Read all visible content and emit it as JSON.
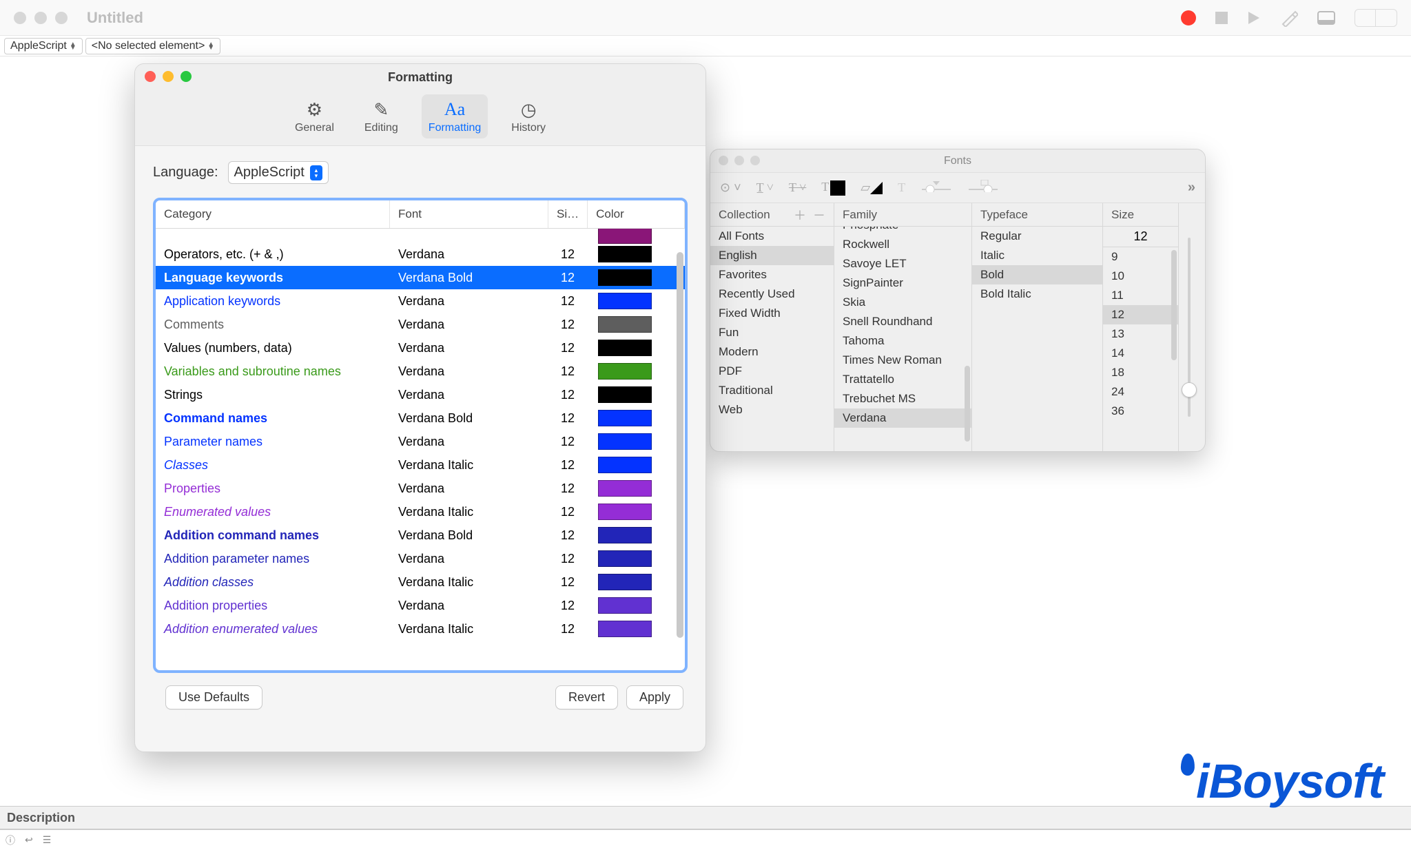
{
  "main_window": {
    "title": "Untitled",
    "language_popup": "AppleScript",
    "element_popup": "<No selected element>",
    "description_label": "Description"
  },
  "prefs": {
    "title": "Formatting",
    "tabs": {
      "general": "General",
      "editing": "Editing",
      "formatting": "Formatting",
      "history": "History"
    },
    "language_label": "Language:",
    "language_value": "AppleScript",
    "columns": {
      "category": "Category",
      "font": "Font",
      "size": "Si…",
      "color": "Color"
    },
    "rows": [
      {
        "category": "Operators, etc. (+ & ,)",
        "font": "Verdana",
        "size": "12",
        "color": "#000000",
        "text_color": "#000000",
        "bold": false,
        "italic": false
      },
      {
        "category": "Language keywords",
        "font": "Verdana Bold",
        "size": "12",
        "color": "#000000",
        "text_color": "#ffffff",
        "bold": true,
        "italic": false,
        "selected": true
      },
      {
        "category": "Application keywords",
        "font": "Verdana",
        "size": "12",
        "color": "#0433ff",
        "text_color": "#0433ff",
        "bold": false,
        "italic": false
      },
      {
        "category": "Comments",
        "font": "Verdana",
        "size": "12",
        "color": "#5e5e5e",
        "text_color": "#5e5e5e",
        "bold": false,
        "italic": false
      },
      {
        "category": "Values (numbers, data)",
        "font": "Verdana",
        "size": "12",
        "color": "#000000",
        "text_color": "#000000",
        "bold": false,
        "italic": false
      },
      {
        "category": "Variables and subroutine names",
        "font": "Verdana",
        "size": "12",
        "color": "#3a9a1a",
        "text_color": "#3a9a1a",
        "bold": false,
        "italic": false
      },
      {
        "category": "Strings",
        "font": "Verdana",
        "size": "12",
        "color": "#000000",
        "text_color": "#000000",
        "bold": false,
        "italic": false
      },
      {
        "category": "Command names",
        "font": "Verdana Bold",
        "size": "12",
        "color": "#0433ff",
        "text_color": "#0433ff",
        "bold": true,
        "italic": false
      },
      {
        "category": "Parameter names",
        "font": "Verdana",
        "size": "12",
        "color": "#0433ff",
        "text_color": "#0433ff",
        "bold": false,
        "italic": false
      },
      {
        "category": "Classes",
        "font": "Verdana Italic",
        "size": "12",
        "color": "#0433ff",
        "text_color": "#0433ff",
        "bold": false,
        "italic": true
      },
      {
        "category": "Properties",
        "font": "Verdana",
        "size": "12",
        "color": "#942dd6",
        "text_color": "#942dd6",
        "bold": false,
        "italic": false
      },
      {
        "category": "Enumerated values",
        "font": "Verdana Italic",
        "size": "12",
        "color": "#942dd6",
        "text_color": "#942dd6",
        "bold": false,
        "italic": true
      },
      {
        "category": "Addition command names",
        "font": "Verdana Bold",
        "size": "12",
        "color": "#2225b8",
        "text_color": "#2225b8",
        "bold": true,
        "italic": false
      },
      {
        "category": "Addition parameter names",
        "font": "Verdana",
        "size": "12",
        "color": "#2225b8",
        "text_color": "#2225b8",
        "bold": false,
        "italic": false
      },
      {
        "category": "Addition classes",
        "font": "Verdana Italic",
        "size": "12",
        "color": "#2225b8",
        "text_color": "#2225b8",
        "bold": false,
        "italic": true
      },
      {
        "category": "Addition properties",
        "font": "Verdana",
        "size": "12",
        "color": "#6131d1",
        "text_color": "#6131d1",
        "bold": false,
        "italic": false
      },
      {
        "category": "Addition enumerated values",
        "font": "Verdana Italic",
        "size": "12",
        "color": "#6131d1",
        "text_color": "#6131d1",
        "bold": false,
        "italic": true
      }
    ],
    "extra_swatch_color": "#8a1678",
    "buttons": {
      "use_defaults": "Use Defaults",
      "revert": "Revert",
      "apply": "Apply"
    }
  },
  "fonts": {
    "title": "Fonts",
    "columns": {
      "collection": "Collection",
      "family": "Family",
      "typeface": "Typeface",
      "size": "Size"
    },
    "size_value": "12",
    "collections": [
      "All Fonts",
      "English",
      "Favorites",
      "Recently Used",
      "Fixed Width",
      "Fun",
      "Modern",
      "PDF",
      "Traditional",
      "Web"
    ],
    "collection_selected": "English",
    "families": [
      "Phosphate",
      "Rockwell",
      "Savoye LET",
      "SignPainter",
      "Skia",
      "Snell Roundhand",
      "Tahoma",
      "Times New Roman",
      "Trattatello",
      "Trebuchet MS",
      "Verdana"
    ],
    "family_selected": "Verdana",
    "typefaces": [
      "Regular",
      "Italic",
      "Bold",
      "Bold Italic"
    ],
    "typeface_selected": "Bold",
    "sizes": [
      "9",
      "10",
      "11",
      "12",
      "13",
      "14",
      "18",
      "24",
      "36"
    ],
    "size_selected": "12"
  },
  "watermark": "iBoysoft"
}
